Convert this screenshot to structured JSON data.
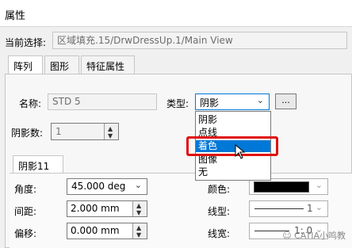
{
  "window": {
    "title": "属性"
  },
  "current_selection": {
    "label": "当前选择:",
    "value": "区域填充.15/DrwDressUp.1/Main View"
  },
  "tabs": [
    {
      "label": "阵列",
      "active": true
    },
    {
      "label": "图形",
      "active": false
    },
    {
      "label": "特征属性",
      "active": false
    }
  ],
  "pattern": {
    "name_label": "名称:",
    "name_value": "STD 5",
    "type_label": "类型:",
    "type_value": "阴影",
    "more_button": "...",
    "count_label": "阴影数:",
    "count_value": "1"
  },
  "type_dropdown": {
    "options": [
      "阴影",
      "点线",
      "着色",
      "图像",
      "无"
    ],
    "selected": "着色"
  },
  "subtab": {
    "label": "阴影11"
  },
  "hatch": {
    "angle_label": "角度:",
    "angle_value": "45.000 deg",
    "spacing_label": "间距:",
    "spacing_value": "2.000 mm",
    "offset_label": "偏移:",
    "offset_value": "0.000 mm",
    "color_label": "颜色:",
    "color_value": "#000000",
    "linetype_label": "线型:",
    "linetype_value": "1",
    "linewidth_label": "线宽:",
    "linewidth_value": "1: 0"
  },
  "watermark": {
    "text": "CATIA小鸣教"
  },
  "colors": {
    "selection_blue": "#0078d7",
    "highlight_red": "#e01010"
  }
}
